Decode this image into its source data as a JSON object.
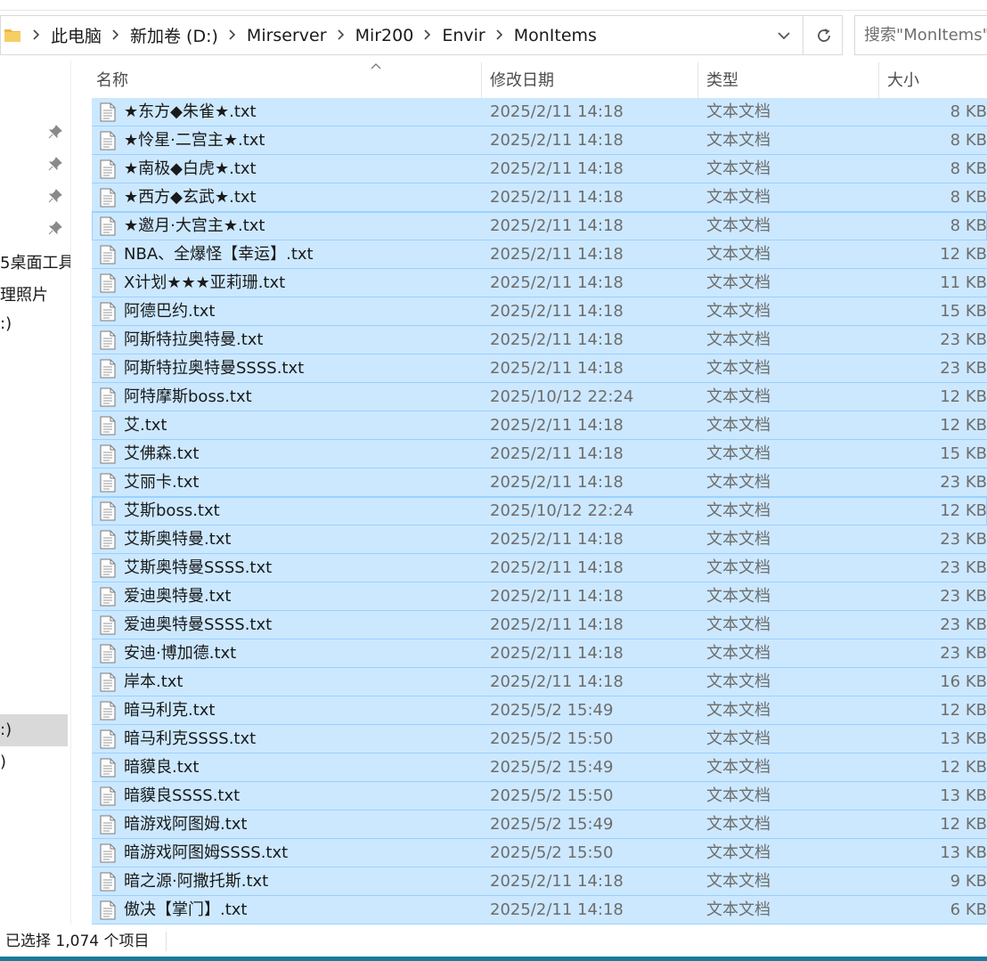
{
  "breadcrumb": [
    "此电脑",
    "新加卷 (D:)",
    "Mirserver",
    "Mir200",
    "Envir",
    "MonItems"
  ],
  "search": {
    "placeholder": "搜索\"MonItems\""
  },
  "nav": {
    "labels": [
      "5桌面工具",
      "理照片",
      ":)",
      ":)",
      ")"
    ]
  },
  "columns": {
    "name": "名称",
    "date": "修改日期",
    "type": "类型",
    "size": "大小"
  },
  "files": [
    {
      "name": "★东方◆朱雀★.txt",
      "date": "2025/2/11 14:18",
      "type": "文本文档",
      "size": "8 KB"
    },
    {
      "name": "★怜星·二宫主★.txt",
      "date": "2025/2/11 14:18",
      "type": "文本文档",
      "size": "8 KB"
    },
    {
      "name": "★南极◆白虎★.txt",
      "date": "2025/2/11 14:18",
      "type": "文本文档",
      "size": "8 KB"
    },
    {
      "name": "★西方◆玄武★.txt",
      "date": "2025/2/11 14:18",
      "type": "文本文档",
      "size": "8 KB"
    },
    {
      "name": "★邀月·大宫主★.txt",
      "date": "2025/2/11 14:18",
      "type": "文本文档",
      "size": "8 KB"
    },
    {
      "name": "NBA、全爆怪【幸运】.txt",
      "date": "2025/2/11 14:18",
      "type": "文本文档",
      "size": "12 KB"
    },
    {
      "name": "X计划★★★亚莉珊.txt",
      "date": "2025/2/11 14:18",
      "type": "文本文档",
      "size": "11 KB"
    },
    {
      "name": "阿德巴约.txt",
      "date": "2025/2/11 14:18",
      "type": "文本文档",
      "size": "15 KB"
    },
    {
      "name": "阿斯特拉奥特曼.txt",
      "date": "2025/2/11 14:18",
      "type": "文本文档",
      "size": "23 KB"
    },
    {
      "name": "阿斯特拉奥特曼SSSS.txt",
      "date": "2025/2/11 14:18",
      "type": "文本文档",
      "size": "23 KB"
    },
    {
      "name": "阿特摩斯boss.txt",
      "date": "2025/10/12 22:24",
      "type": "文本文档",
      "size": "12 KB"
    },
    {
      "name": "艾.txt",
      "date": "2025/2/11 14:18",
      "type": "文本文档",
      "size": "12 KB"
    },
    {
      "name": "艾佛森.txt",
      "date": "2025/2/11 14:18",
      "type": "文本文档",
      "size": "15 KB"
    },
    {
      "name": "艾丽卡.txt",
      "date": "2025/2/11 14:18",
      "type": "文本文档",
      "size": "23 KB"
    },
    {
      "name": "艾斯boss.txt",
      "date": "2025/10/12 22:24",
      "type": "文本文档",
      "size": "12 KB"
    },
    {
      "name": "艾斯奥特曼.txt",
      "date": "2025/2/11 14:18",
      "type": "文本文档",
      "size": "23 KB"
    },
    {
      "name": "艾斯奥特曼SSSS.txt",
      "date": "2025/2/11 14:18",
      "type": "文本文档",
      "size": "23 KB"
    },
    {
      "name": "爱迪奥特曼.txt",
      "date": "2025/2/11 14:18",
      "type": "文本文档",
      "size": "23 KB"
    },
    {
      "name": "爱迪奥特曼SSSS.txt",
      "date": "2025/2/11 14:18",
      "type": "文本文档",
      "size": "23 KB"
    },
    {
      "name": "安迪·博加德.txt",
      "date": "2025/2/11 14:18",
      "type": "文本文档",
      "size": "23 KB"
    },
    {
      "name": "岸本.txt",
      "date": "2025/2/11 14:18",
      "type": "文本文档",
      "size": "16 KB"
    },
    {
      "name": "暗马利克.txt",
      "date": "2025/5/2 15:49",
      "type": "文本文档",
      "size": "12 KB"
    },
    {
      "name": "暗马利克SSSS.txt",
      "date": "2025/5/2 15:50",
      "type": "文本文档",
      "size": "13 KB"
    },
    {
      "name": "暗貘良.txt",
      "date": "2025/5/2 15:49",
      "type": "文本文档",
      "size": "12 KB"
    },
    {
      "name": "暗貘良SSSS.txt",
      "date": "2025/5/2 15:50",
      "type": "文本文档",
      "size": "13 KB"
    },
    {
      "name": "暗游戏阿图姆.txt",
      "date": "2025/5/2 15:49",
      "type": "文本文档",
      "size": "12 KB"
    },
    {
      "name": "暗游戏阿图姆SSSS.txt",
      "date": "2025/5/2 15:50",
      "type": "文本文档",
      "size": "13 KB"
    },
    {
      "name": "暗之源·阿撒托斯.txt",
      "date": "2025/2/11 14:18",
      "type": "文本文档",
      "size": "9 KB"
    },
    {
      "name": "傲决【掌门】.txt",
      "date": "2025/2/11 14:18",
      "type": "文本文档",
      "size": "6 KB"
    }
  ],
  "status": {
    "selection": "已选择 1,074 个项目"
  },
  "colors": {
    "selection_bg": "#cce8ff",
    "selection_border": "#99d1ff",
    "accent": "#1a7a9c"
  },
  "icons": [
    "folder-icon",
    "chevron-right-icon",
    "chevron-down-icon",
    "refresh-icon",
    "pin-icon",
    "text-file-icon",
    "sort-up-icon"
  ]
}
